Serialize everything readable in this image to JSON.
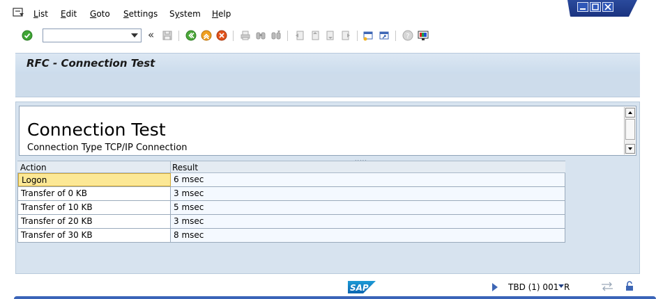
{
  "menu": {
    "items": [
      {
        "label": "List",
        "underline": "L"
      },
      {
        "label": "Edit",
        "underline": "E"
      },
      {
        "label": "Goto",
        "underline": "G"
      },
      {
        "label": "Settings",
        "underline": "S"
      },
      {
        "label": "System",
        "underline": "y"
      },
      {
        "label": "Help",
        "underline": "H"
      }
    ]
  },
  "toolbar": {
    "command_value": "",
    "back_glyph": "«"
  },
  "title": "RFC - Connection Test",
  "header": {
    "heading": "Connection Test",
    "subheading": "Connection Type TCP/IP Connection"
  },
  "table": {
    "columns": [
      "Action",
      "Result"
    ],
    "rows": [
      {
        "action": "Logon",
        "result": "6 msec"
      },
      {
        "action": "Transfer of 0 KB",
        "result": "3 msec"
      },
      {
        "action": "Transfer of 10 KB",
        "result": "5 msec"
      },
      {
        "action": "Transfer of 20 KB",
        "result": "3 msec"
      },
      {
        "action": "Transfer of 30 KB",
        "result": "8 msec"
      }
    ],
    "selected_row": 0
  },
  "status": {
    "logo_text": "SAP",
    "system_info": "TBD (1) 001",
    "system_suffix": "R"
  },
  "colors": {
    "accent": "#3a64b8",
    "selection": "#fce895",
    "panel": "#d7e3ef"
  }
}
